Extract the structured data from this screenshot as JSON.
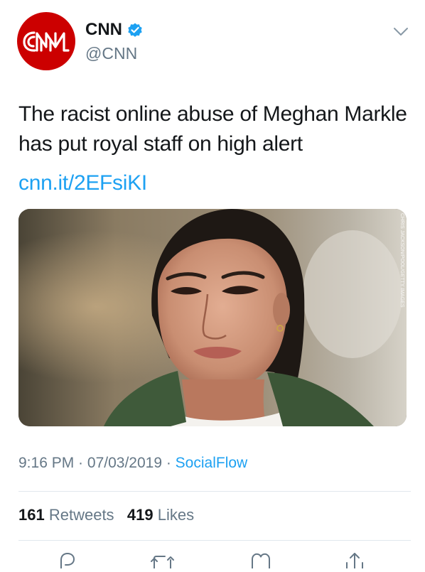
{
  "author": {
    "name": "CNN",
    "handle": "@CNN",
    "avatar_text": "CNN",
    "avatar_color": "#cc0000",
    "verified": true
  },
  "tweet": {
    "text": "The racist online abuse of Meghan Markle has put royal staff on high alert",
    "link": "cnn.it/2EFsiKI",
    "media_credit": "CHRIS JACKSON/POOL/GETTY IMAGES"
  },
  "meta": {
    "time": "9:16 PM",
    "separator": " · ",
    "date": "07/03/2019",
    "source": "SocialFlow"
  },
  "stats": {
    "retweets_count": "161",
    "retweets_label": "Retweets",
    "likes_count": "419",
    "likes_label": "Likes"
  },
  "icons": [
    "chevron-down-icon",
    "verified-badge-icon",
    "reply-icon",
    "retweet-icon",
    "like-icon",
    "share-icon"
  ],
  "colors": {
    "link": "#1da1f2",
    "muted": "#657786",
    "text": "#14171a",
    "divider": "#e1e8ed"
  }
}
